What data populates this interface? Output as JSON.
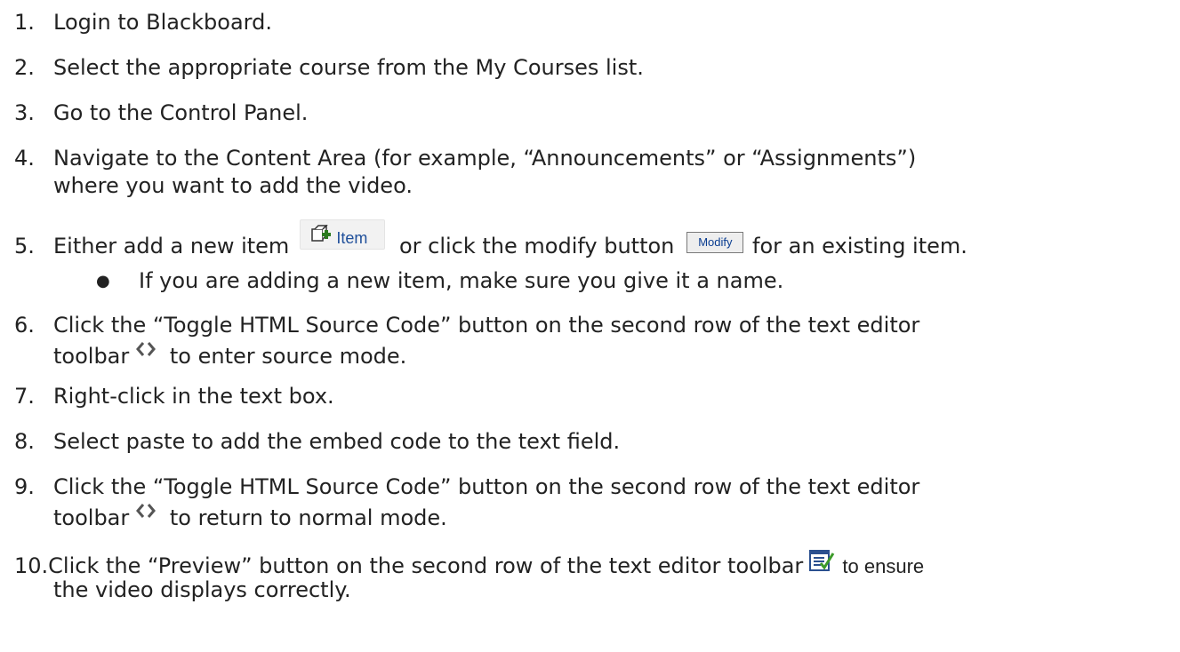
{
  "steps": [
    {
      "num": "1.",
      "text": "Login to Blackboard."
    },
    {
      "num": "2.",
      "text": "Select the appropriate course from the My Courses list."
    },
    {
      "num": "3.",
      "text": "Go to the Control Panel."
    },
    {
      "num": "4.",
      "line1": "Navigate to the Content Area (for example, “Announcements” or “Assignments”)",
      "line2": "where you want to add the video."
    },
    {
      "num": "5.",
      "before": "Either add a new item",
      "middle": "or click the modify button",
      "after": "for an existing item.",
      "item_button_label": "Item",
      "modify_button_label": "Modify",
      "bullet": "If you are adding a new item, make sure you give it a name."
    },
    {
      "num": "6.",
      "line1": "Click the “Toggle HTML Source Code” button on the second row of the text editor",
      "line2_before": "toolbar",
      "line2_after": "to enter source mode."
    },
    {
      "num": "7.",
      "text": "Right-click in the text box."
    },
    {
      "num": "8.",
      "text": "Select paste to add the embed code to the text field."
    },
    {
      "num": "9.",
      "line1": "Click the “Toggle HTML Source Code” button on the second row of the text editor",
      "line2_before": "toolbar",
      "line2_after": "to return to normal mode."
    },
    {
      "num": "10.",
      "line1_before": "Click the “Preview” button on the second row of the text editor toolbar",
      "line1_after": "to ensure",
      "line2": "the video displays correctly."
    }
  ],
  "icons": {
    "item_icon": "add-item-icon",
    "source_icon": "toggle-html-source-icon",
    "preview_icon": "preview-icon",
    "item_label_color": "#1f4f9a",
    "modify_label_color": "#0a3d91"
  }
}
